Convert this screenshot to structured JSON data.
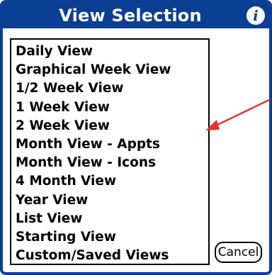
{
  "dialog": {
    "title": "View Selection",
    "info_icon_glyph": "i",
    "icon": "info-icon"
  },
  "view_list": {
    "items": [
      "Daily View",
      "Graphical Week View",
      "1/2 Week View",
      "1 Week View",
      "2 Week View",
      "Month View - Appts",
      "Month View - Icons",
      "4 Month View",
      "Year View",
      "List View",
      "Starting View",
      "Custom/Saved Views"
    ]
  },
  "buttons": {
    "cancel_label": "Cancel"
  },
  "colors": {
    "title_bar": "#0b3f93",
    "annotation_arrow": "#e8312f",
    "text": "#000000",
    "background": "#ffffff"
  }
}
